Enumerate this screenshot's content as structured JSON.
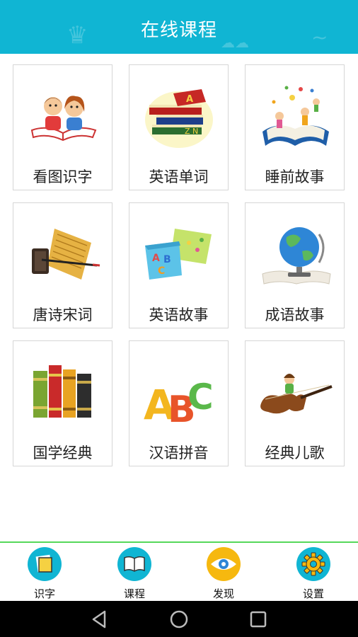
{
  "header": {
    "title": "在线课程"
  },
  "courses": [
    {
      "label": "看图识字",
      "icon": "kids-reading-icon"
    },
    {
      "label": "英语单词",
      "icon": "book-stack-icon"
    },
    {
      "label": "睡前故事",
      "icon": "fairy-tale-book-icon"
    },
    {
      "label": "唐诗宋词",
      "icon": "scroll-brush-icon"
    },
    {
      "label": "英语故事",
      "icon": "abc-books-icon"
    },
    {
      "label": "成语故事",
      "icon": "globe-icon"
    },
    {
      "label": "国学经典",
      "icon": "classic-books-icon"
    },
    {
      "label": "汉语拼音",
      "icon": "abc-letters-icon"
    },
    {
      "label": "经典儿歌",
      "icon": "violin-icon"
    }
  ],
  "tabs": [
    {
      "label": "识字",
      "icon": "note-icon",
      "color": "#10b5d3"
    },
    {
      "label": "课程",
      "icon": "open-book-icon",
      "color": "#10b5d3"
    },
    {
      "label": "发现",
      "icon": "eye-icon",
      "color": "#f6b80f"
    },
    {
      "label": "设置",
      "icon": "gear-icon",
      "color": "#10b5d3"
    }
  ],
  "colors": {
    "header": "#10b5d3",
    "tab_divider": "#55d85a"
  }
}
